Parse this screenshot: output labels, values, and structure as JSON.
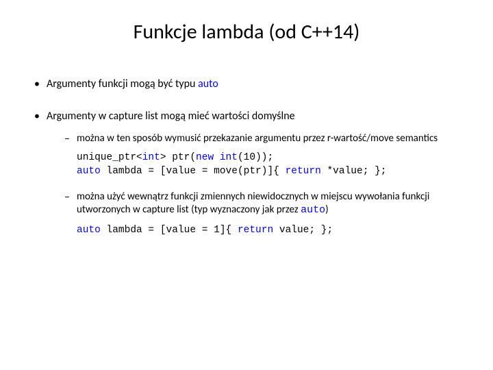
{
  "title": "Funkcje lambda (od C++14)",
  "bullet1_prefix": "Argumenty funkcji mogą być typu ",
  "bullet1_auto": "auto",
  "bullet2": "Argumenty w capture list mogą mieć wartości domyślne",
  "sub1": "można w ten sposób wymusić przekazanie argumentu przez r-wartość/move semantics",
  "sub2_part1": "można użyć wewnątrz funkcji zmiennych niewidocznych w miejscu wywołania funkcji utworzonych w capture list (typ wyznaczony jak przez ",
  "sub2_auto": "auto",
  "sub2_part2": ")",
  "code1": {
    "l1a": "unique_ptr<",
    "l1b": "int",
    "l1c": "> ptr(",
    "l1d": "new",
    "l1e": " ",
    "l1f": "int",
    "l1g": "(10));",
    "l2a": "auto",
    "l2b": " lambda = [value = move(ptr)]{ ",
    "l2c": "return",
    "l2d": " *value; };"
  },
  "code2": {
    "l1a": "auto",
    "l1b": " lambda = [value = 1]{ ",
    "l1c": "return",
    "l1d": " value; };"
  }
}
